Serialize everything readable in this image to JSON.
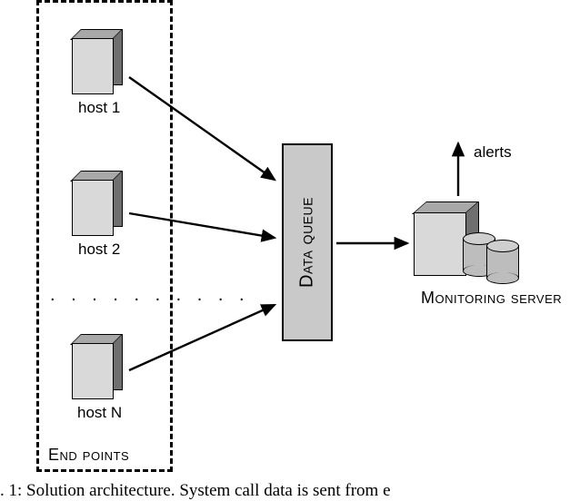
{
  "diagram": {
    "endpoints_label": "End points",
    "hosts": {
      "host1": "host 1",
      "host2": "host 2",
      "hostN": "host N"
    },
    "ellipsis": ". . . . . . . . . .",
    "queue_label": "Data queue",
    "server_label": "Monitoring server",
    "alerts_label": "alerts"
  },
  "caption": ". 1: Solution architecture. System call data is sent from e"
}
